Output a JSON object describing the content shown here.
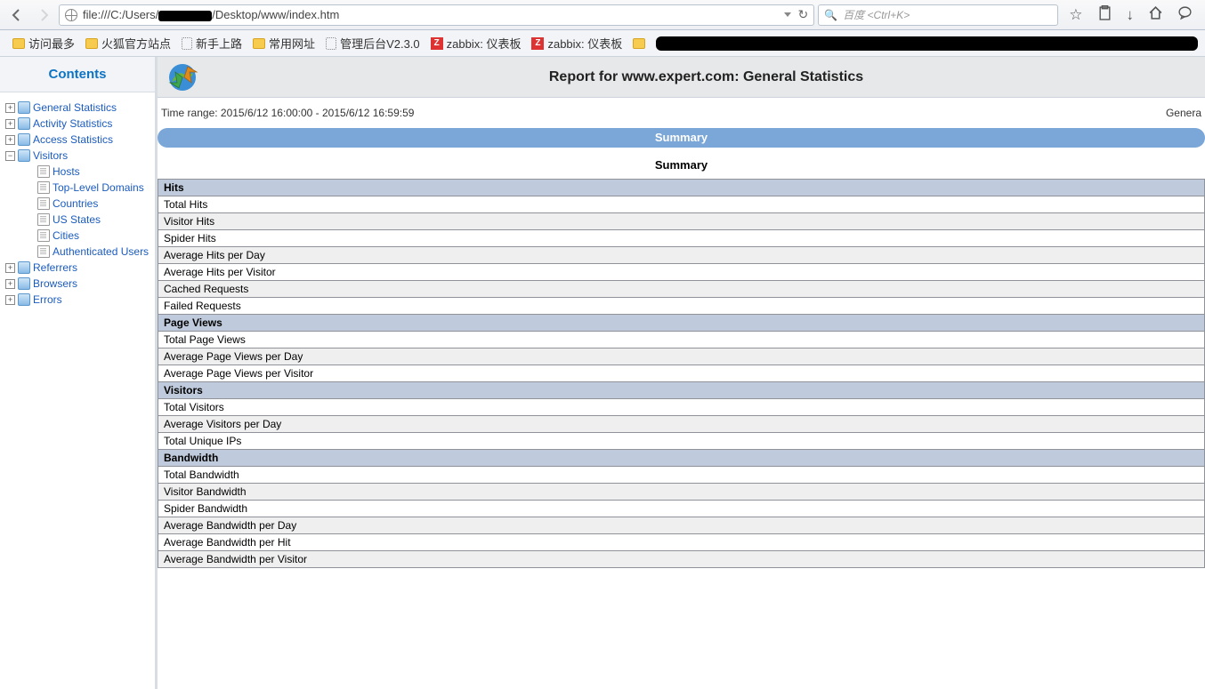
{
  "browser": {
    "url_prefix": "file:///C:/Users/",
    "url_suffix": "/Desktop/www/index.htm",
    "search_placeholder": "百度 <Ctrl+K>"
  },
  "bookmarks": [
    {
      "icon": "folder",
      "label": "访问最多"
    },
    {
      "icon": "folder",
      "label": "火狐官方站点"
    },
    {
      "icon": "page",
      "label": "新手上路"
    },
    {
      "icon": "folder",
      "label": "常用网址"
    },
    {
      "icon": "page",
      "label": "管理后台V2.3.0"
    },
    {
      "icon": "z",
      "label": "zabbix: 仪表板"
    },
    {
      "icon": "z",
      "label": "zabbix: 仪表板"
    }
  ],
  "sidebar": {
    "title": "Contents",
    "items": [
      {
        "label": "General Statistics",
        "exp": "plus"
      },
      {
        "label": "Activity Statistics",
        "exp": "plus"
      },
      {
        "label": "Access Statistics",
        "exp": "plus"
      },
      {
        "label": "Visitors",
        "exp": "minus",
        "children": [
          "Hosts",
          "Top-Level Domains",
          "Countries",
          "US States",
          "Cities",
          "Authenticated Users"
        ]
      },
      {
        "label": "Referrers",
        "exp": "plus"
      },
      {
        "label": "Browsers",
        "exp": "plus"
      },
      {
        "label": "Errors",
        "exp": "plus"
      }
    ]
  },
  "report": {
    "title": "Report for www.expert.com: General Statistics",
    "time_range": "Time range: 2015/6/12 16:00:00 - 2015/6/12 16:59:59",
    "breadcrumb": "Genera",
    "section": "Summary",
    "summary_label": "Summary",
    "groups": [
      {
        "header": "Hits",
        "rows": [
          "Total Hits",
          "Visitor Hits",
          "Spider Hits",
          "Average Hits per Day",
          "Average Hits per Visitor",
          "Cached Requests",
          "Failed Requests"
        ]
      },
      {
        "header": "Page Views",
        "rows": [
          "Total Page Views",
          "Average Page Views per Day",
          "Average Page Views per Visitor"
        ]
      },
      {
        "header": "Visitors",
        "rows": [
          "Total Visitors",
          "Average Visitors per Day",
          "Total Unique IPs"
        ]
      },
      {
        "header": "Bandwidth",
        "rows": [
          "Total Bandwidth",
          "Visitor Bandwidth",
          "Spider Bandwidth",
          "Average Bandwidth per Day",
          "Average Bandwidth per Hit",
          "Average Bandwidth per Visitor"
        ]
      }
    ]
  }
}
